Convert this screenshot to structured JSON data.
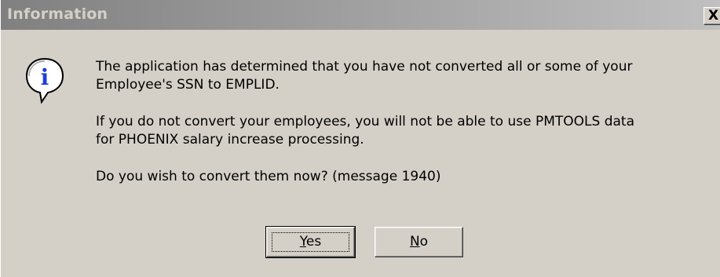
{
  "window": {
    "title": "Information",
    "close_glyph": "X"
  },
  "icon": {
    "name": "information-icon",
    "letter": "i",
    "color": "#1f3fd6"
  },
  "message": {
    "paragraph1_line1": "The application has determined that you have not converted all or some of your",
    "paragraph1_line2": "Employee's SSN to EMPLID.",
    "paragraph2_line1": "If you do not convert your employees, you will not be able to use PMTOOLS data",
    "paragraph2_line2": "for PHOENIX salary increase processing.",
    "paragraph3": "Do you wish to convert them now? (message 1940)"
  },
  "buttons": {
    "yes_mnemonic": "Y",
    "yes_rest": "es",
    "no_mnemonic": "N",
    "no_rest": "o"
  },
  "colors": {
    "dialog_bg": "#d4d0c8",
    "titlebar_start": "#808080",
    "titlebar_end": "#c0c0c0"
  }
}
